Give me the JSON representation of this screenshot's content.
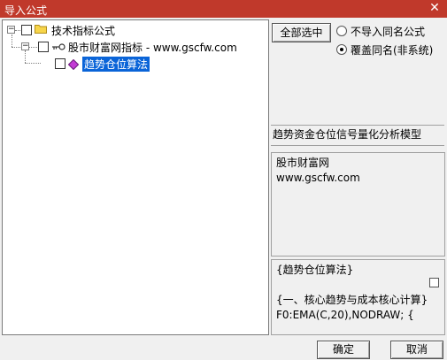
{
  "window": {
    "title": "导入公式",
    "close_glyph": "✕"
  },
  "tree": {
    "root": {
      "label": "技术指标公式",
      "expander": "−"
    },
    "child": {
      "label": "股市财富网指标 - www.gscfw.com",
      "expander": "−"
    },
    "leaf": {
      "label": "趋势仓位算法"
    }
  },
  "options": {
    "select_all_button": "全部选中",
    "radio_skip_label": "不导入同名公式",
    "radio_overwrite_label": "覆盖同名(非系统)",
    "selected_radio": "overwrite"
  },
  "description": {
    "title": "趋势资金仓位信号量化分析模型",
    "author_lines": [
      "股市财富网",
      "www.gscfw.com"
    ],
    "code_lines": [
      "{趋势仓位算法}",
      "",
      "{一、核心趋势与成本核心计算}",
      "F0:EMA(C,20),NODRAW;  {"
    ]
  },
  "footer": {
    "ok_button": "确定",
    "cancel_button": "取消"
  }
}
